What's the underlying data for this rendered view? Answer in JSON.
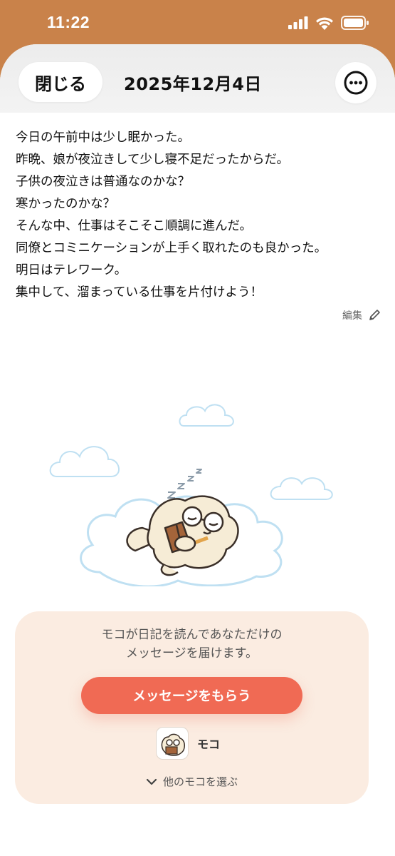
{
  "status_bar": {
    "time": "11:22",
    "icons": [
      "signal-icon",
      "wifi-icon",
      "battery-icon"
    ]
  },
  "header": {
    "close_label": "閉じる",
    "date": "2025年12月4日",
    "more_icon": "ellipsis-icon"
  },
  "diary": {
    "lines": [
      "今日の午前中は少し眠かった。",
      "昨晩、娘が夜泣きして少し寝不足だったからだ。",
      "子供の夜泣きは普通なのかな？",
      "寒かったのかな？",
      "そんな中、仕事はそこそこ順調に進んだ。",
      "同僚とコミニケーションが上手く取れたのも良かった。",
      "明日はテレワーク。",
      "集中して、溜まっている仕事を片付けよう！"
    ],
    "edit_label": "編集",
    "edit_icon": "pencil-icon"
  },
  "message_card": {
    "desc_line1": "モコが日記を読んであなただけの",
    "desc_line2": "メッセージを届けます。",
    "cta_label": "メッセージをもらう",
    "character_name": "モコ",
    "choose_label": "他のモコを選ぶ",
    "choose_icon": "chevron-down-icon"
  },
  "colors": {
    "accent": "#f06a54",
    "card_background": "#fbece1",
    "status_bar_background": "#c9824a"
  }
}
